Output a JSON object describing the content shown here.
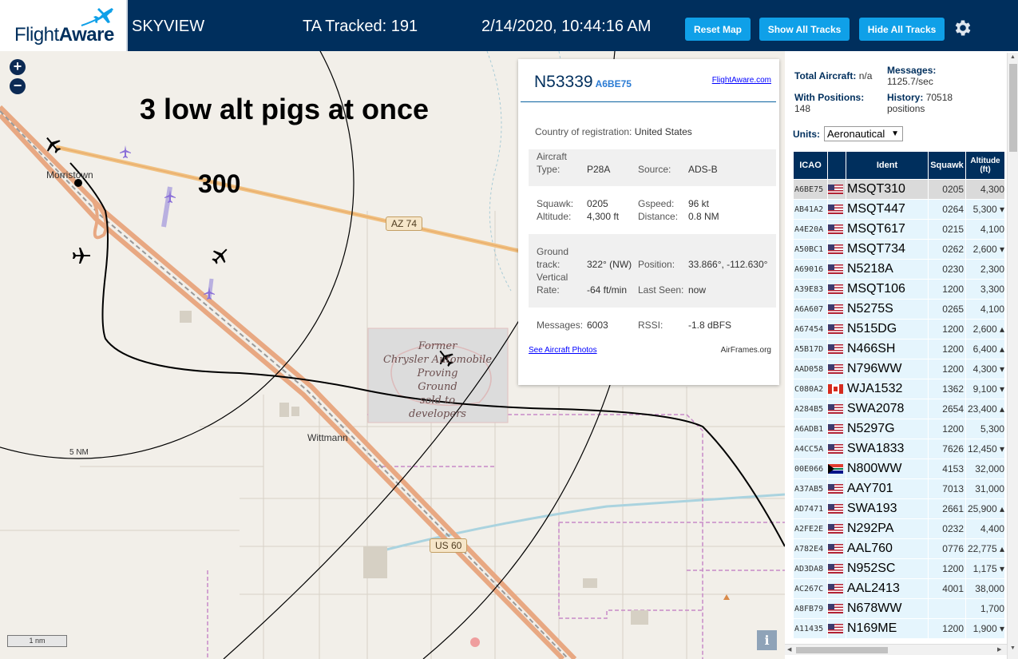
{
  "header": {
    "logo_text_a": "Flight",
    "logo_text_b": "Aware",
    "app_name": "SKYVIEW",
    "tracked_label": "TA Tracked: 191",
    "timestamp": "2/14/2020, 10:44:16 AM",
    "reset_map": "Reset Map",
    "show_all_tracks": "Show All Tracks",
    "hide_all_tracks": "Hide All Tracks",
    "settings_icon": "gear-icon"
  },
  "map": {
    "zoom_in": "+",
    "zoom_out": "−",
    "annotation_main": "3 low alt pigs at once",
    "annotation_alt": "300",
    "labels": {
      "morristown": "Morristown",
      "wittmann": "Wittmann",
      "range_ring": "5 NM",
      "az74": "AZ 74",
      "us60": "US 60",
      "former_line1": "Former",
      "former_line2": "Chrysler Automobile",
      "former_line3": "Proving",
      "former_line4": "Ground",
      "former_line5": "sold to",
      "former_line6": "developers"
    },
    "scale": "1 nm",
    "info": "i"
  },
  "popup": {
    "registration": "N53339",
    "hex": "A6BE75",
    "fa_link": "FlightAware.com",
    "country_label": "Country of registration:",
    "country": "United States",
    "aircraft_type_label_1": "Aircraft",
    "aircraft_type_label_2": "Type:",
    "aircraft_type": "P28A",
    "source_label": "Source:",
    "source": "ADS-B",
    "squawk_label": "Squawk:",
    "squawk": "0205",
    "gspeed_label": "Gspeed:",
    "gspeed": "96 kt",
    "altitude_label": "Altitude:",
    "altitude": "4,300 ft",
    "distance_label": "Distance:",
    "distance": "0.8 NM",
    "ground_label_1": "Ground",
    "ground_label_2": "track:",
    "ground_track": "322° (NW)",
    "position_label": "Position:",
    "position": "33.866°, -112.630°",
    "vrate_label_1": "Vertical",
    "vrate_label_2": "Rate:",
    "vertical_rate": "-64 ft/min",
    "last_seen_label": "Last Seen:",
    "last_seen": "now",
    "messages_label": "Messages:",
    "messages": "6003",
    "rssi_label": "RSSI:",
    "rssi": "-1.8 dBFS",
    "photos_link": "See Aircraft Photos",
    "airframes": "AirFrames.org"
  },
  "sidebar": {
    "total_label": "Total Aircraft:",
    "total_value": "n/a",
    "messages_label": "Messages:",
    "messages_value": "1125.7/sec",
    "positions_label": "With Positions:",
    "positions_value": "148",
    "history_label": "History:",
    "history_value": "70518",
    "history_unit": "positions",
    "units_label": "Units:",
    "units_value": "Aeronautical",
    "columns": [
      "ICAO",
      "",
      "Ident",
      "Squawk",
      "Altitude (ft)"
    ],
    "rows": [
      {
        "icao": "A6BE75",
        "flag": "us",
        "ident": "MSQT310",
        "squawk": "0205",
        "alt": "4,300",
        "selected": true
      },
      {
        "icao": "AB41A2",
        "flag": "us",
        "ident": "MSQT447",
        "squawk": "0264",
        "alt": "5,300 ▾"
      },
      {
        "icao": "A4E20A",
        "flag": "us",
        "ident": "MSQT617",
        "squawk": "0215",
        "alt": "4,100"
      },
      {
        "icao": "A50BC1",
        "flag": "us",
        "ident": "MSQT734",
        "squawk": "0262",
        "alt": "2,600 ▾"
      },
      {
        "icao": "A69016",
        "flag": "us",
        "ident": "N5218A",
        "squawk": "0230",
        "alt": "2,300"
      },
      {
        "icao": "A39E83",
        "flag": "us",
        "ident": "MSQT106",
        "squawk": "1200",
        "alt": "3,300"
      },
      {
        "icao": "A6A607",
        "flag": "us",
        "ident": "N5275S",
        "squawk": "0265",
        "alt": "4,100"
      },
      {
        "icao": "A67454",
        "flag": "us",
        "ident": "N515DG",
        "squawk": "1200",
        "alt": "2,600 ▴"
      },
      {
        "icao": "A5B17D",
        "flag": "us",
        "ident": "N466SH",
        "squawk": "1200",
        "alt": "6,400 ▴"
      },
      {
        "icao": "AAD058",
        "flag": "us",
        "ident": "N796WW",
        "squawk": "1200",
        "alt": "4,300 ▾"
      },
      {
        "icao": "C080A2",
        "flag": "ca",
        "ident": "WJA1532",
        "squawk": "1362",
        "alt": "9,100 ▾"
      },
      {
        "icao": "A284B5",
        "flag": "us",
        "ident": "SWA2078",
        "squawk": "2654",
        "alt": "23,400 ▴"
      },
      {
        "icao": "A6ADB1",
        "flag": "us",
        "ident": "N5297G",
        "squawk": "1200",
        "alt": "5,300"
      },
      {
        "icao": "A4CC5A",
        "flag": "us",
        "ident": "SWA1833",
        "squawk": "7626",
        "alt": "12,450 ▾"
      },
      {
        "icao": "00E066",
        "flag": "za",
        "ident": "N800WW",
        "squawk": "4153",
        "alt": "32,000"
      },
      {
        "icao": "A37AB5",
        "flag": "us",
        "ident": "AAY701",
        "squawk": "7013",
        "alt": "31,000"
      },
      {
        "icao": "AD7471",
        "flag": "us",
        "ident": "SWA193",
        "squawk": "2661",
        "alt": "25,900 ▴"
      },
      {
        "icao": "A2FE2E",
        "flag": "us",
        "ident": "N292PA",
        "squawk": "0232",
        "alt": "4,400"
      },
      {
        "icao": "A782E4",
        "flag": "us",
        "ident": "AAL760",
        "squawk": "0776",
        "alt": "22,775 ▴"
      },
      {
        "icao": "AD3DA8",
        "flag": "us",
        "ident": "N952SC",
        "squawk": "1200",
        "alt": "1,175 ▾"
      },
      {
        "icao": "AC267C",
        "flag": "us",
        "ident": "AAL2413",
        "squawk": "4001",
        "alt": "38,000"
      },
      {
        "icao": "A8FB79",
        "flag": "us",
        "ident": "N678WW",
        "squawk": "",
        "alt": "1,700"
      },
      {
        "icao": "A11435",
        "flag": "us",
        "ident": "N169ME",
        "squawk": "1200",
        "alt": "1,900 ▾"
      }
    ]
  }
}
